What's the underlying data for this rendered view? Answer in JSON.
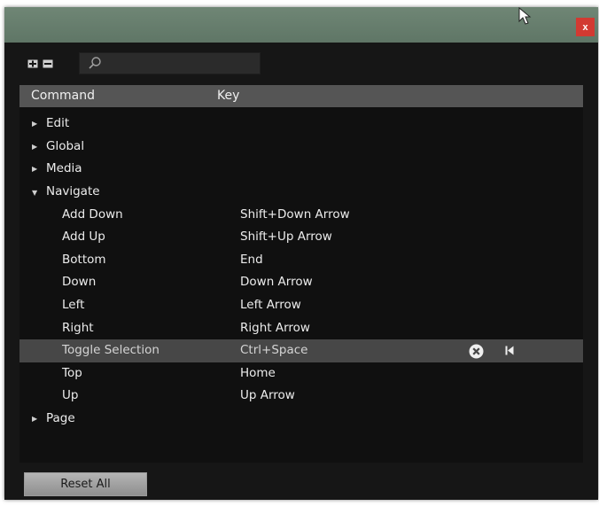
{
  "window": {
    "close_label": "x"
  },
  "search": {
    "placeholder": ""
  },
  "table": {
    "header": {
      "command": "Command",
      "key": "Key"
    },
    "groups_before": [
      {
        "label": "Edit",
        "expanded": false
      },
      {
        "label": "Global",
        "expanded": false
      },
      {
        "label": "Media",
        "expanded": false
      },
      {
        "label": "Navigate",
        "expanded": true
      }
    ],
    "navigate_items": [
      {
        "command": "Add Down",
        "key": "Shift+Down Arrow"
      },
      {
        "command": "Add Up",
        "key": "Shift+Up Arrow"
      },
      {
        "command": "Bottom",
        "key": "End"
      },
      {
        "command": "Down",
        "key": "Down Arrow"
      },
      {
        "command": "Left",
        "key": "Left Arrow"
      },
      {
        "command": "Right",
        "key": "Right Arrow"
      },
      {
        "command": "Toggle Selection",
        "key": "Ctrl+Space",
        "selected": true
      },
      {
        "command": "Top",
        "key": "Home"
      },
      {
        "command": "Up",
        "key": "Up Arrow"
      }
    ],
    "groups_after": [
      {
        "label": "Page",
        "expanded": false
      }
    ]
  },
  "footer": {
    "reset_label": "Reset All"
  },
  "icons": {
    "expand_all": "expand-all-icon",
    "collapse_all": "collapse-all-icon",
    "search": "search-icon",
    "clear": "clear-icon",
    "reset_default": "reset-default-icon",
    "cursor": "mouse-cursor-icon"
  },
  "colors": {
    "title_bar": "#6a8170",
    "close_button": "#d23a32",
    "panel_background": "#101010",
    "header_background": "#555555",
    "selected_row": "#474747",
    "reset_button": "#a3a3a3"
  }
}
